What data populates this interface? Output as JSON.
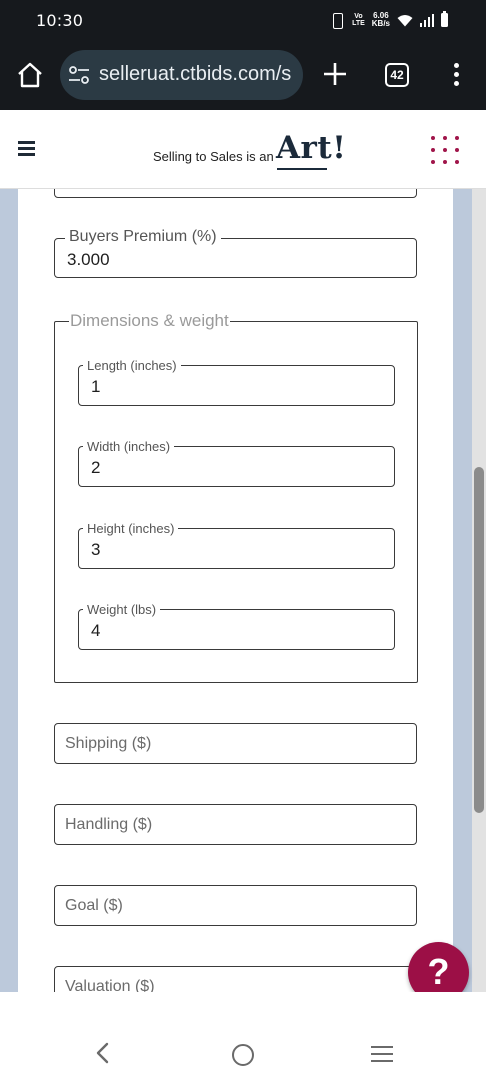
{
  "status_bar": {
    "time": "10:30",
    "network_label_top": "Vo",
    "network_label_bottom": "LTE",
    "speed_value": "6.06",
    "speed_unit": "KB/s"
  },
  "browser": {
    "url": "selleruat.ctbids.com/s",
    "tab_count": "42"
  },
  "site_header": {
    "tagline": "Selling to Sales is an",
    "logo_text": "Art!",
    "brand_color": "#a0154a"
  },
  "form": {
    "buyers_premium": {
      "label": "Buyers Premium (%)",
      "value": "3.000"
    },
    "dimensions": {
      "legend": "Dimensions & weight",
      "length": {
        "label": "Length (inches)",
        "value": "1"
      },
      "width": {
        "label": "Width (inches)",
        "value": "2"
      },
      "height": {
        "label": "Height (inches)",
        "value": "3"
      },
      "weight": {
        "label": "Weight (lbs)",
        "value": "4"
      }
    },
    "shipping": {
      "placeholder": "Shipping ($)"
    },
    "handling": {
      "placeholder": "Handling ($)"
    },
    "goal": {
      "placeholder": "Goal ($)"
    },
    "valuation": {
      "placeholder": "Valuation ($)"
    }
  },
  "help_button": {
    "label": "?",
    "color": "#9c0f46"
  },
  "icons": {
    "home": "home-icon",
    "site_info": "tune-icon",
    "new_tab": "plus-icon",
    "menu": "more-vert-icon",
    "hamburger": "hamburger-icon",
    "apps_grid": "grid-dots-icon",
    "nav_back": "chevron-left-icon",
    "nav_home": "circle-icon",
    "nav_recents": "menu-lines-icon"
  }
}
